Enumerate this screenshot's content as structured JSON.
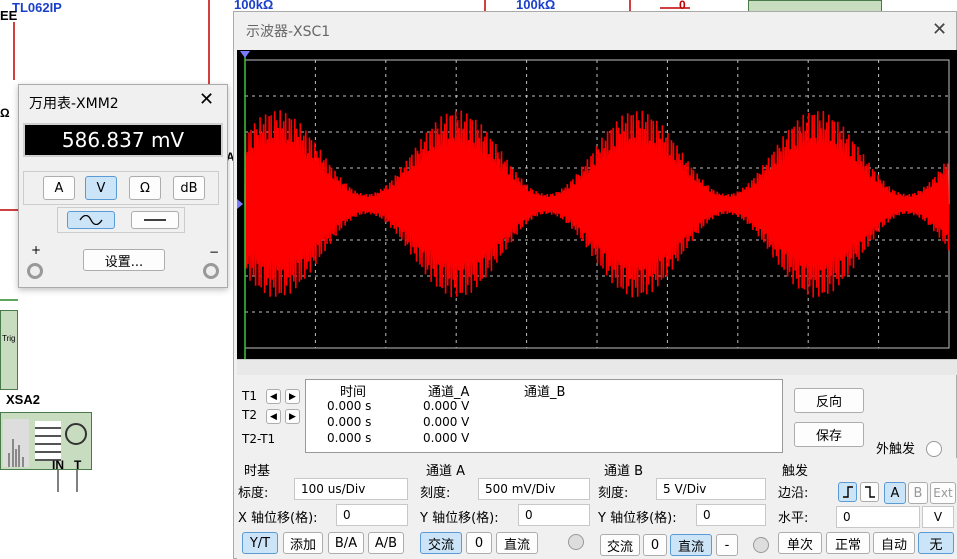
{
  "schematic": {
    "labels": [
      "TL062IP",
      "EE",
      "100kΩ",
      "100kΩ",
      "Ω",
      "A",
      "XSA2",
      "Trig",
      "IN",
      "T",
      "0"
    ]
  },
  "multimeter": {
    "title": "万用表-XMM2",
    "reading": "586.837 mV",
    "modes": [
      "A",
      "V",
      "Ω",
      "dB"
    ],
    "selected_mode": "V",
    "settings_label": "设置...",
    "plus": "+",
    "minus": "−"
  },
  "scope": {
    "title": "示波器-XSC1",
    "readout": {
      "headers": [
        "时间",
        "通道_A",
        "通道_B"
      ],
      "rows": [
        {
          "label": "T1",
          "time": "0.000 s",
          "a": "0.000 V",
          "b": ""
        },
        {
          "label": "T2",
          "time": "0.000 s",
          "a": "0.000 V",
          "b": ""
        },
        {
          "label": "T2-T1",
          "time": "0.000 s",
          "a": "0.000 V",
          "b": ""
        }
      ]
    },
    "reverse_label": "反向",
    "save_label": "保存",
    "ext_trigger_label": "外触发",
    "timebase": {
      "title": "时基",
      "scale_label": "标度:",
      "scale": "100 us/Div",
      "xpos_label": "X 轴位移(格):",
      "xpos": "0",
      "buttons": [
        "Y/T",
        "添加",
        "B/A",
        "A/B"
      ]
    },
    "channel_a": {
      "title": "通道 A",
      "scale_label": "刻度:",
      "scale": "500 mV/Div",
      "ypos_label": "Y 轴位移(格):",
      "ypos": "0",
      "coupling": [
        "交流",
        "0",
        "直流"
      ]
    },
    "channel_b": {
      "title": "通道 B",
      "scale_label": "刻度:",
      "scale": "5  V/Div",
      "ypos_label": "Y 轴位移(格):",
      "ypos": "0",
      "coupling": [
        "交流",
        "0",
        "直流"
      ],
      "minus": "-"
    },
    "trigger": {
      "title": "触发",
      "edge_label": "边沿:",
      "level_label": "水平:",
      "level": "0",
      "unit": "V",
      "sources": [
        "A",
        "B",
        "Ext"
      ],
      "modes": [
        "单次",
        "正常",
        "自动",
        "无"
      ],
      "selected_mode": "无"
    }
  },
  "colors": {
    "trace": "#ff0000",
    "screen": "#000000",
    "grid": "#bfbfbf"
  }
}
